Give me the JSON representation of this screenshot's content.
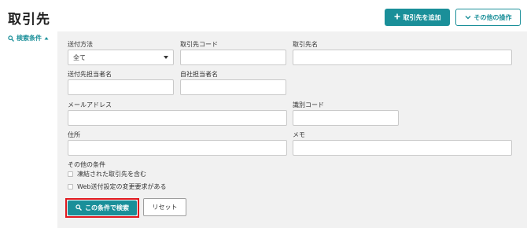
{
  "page": {
    "title": "取引先"
  },
  "header": {
    "add_button_label": "取引先を追加",
    "other_ops_label": "その他の操作"
  },
  "sidebar": {
    "search_toggle_label": "検索条件"
  },
  "form": {
    "delivery_method": {
      "label": "送付方法",
      "value": "全て"
    },
    "partner_code": {
      "label": "取引先コード",
      "value": ""
    },
    "partner_name": {
      "label": "取引先名",
      "value": ""
    },
    "recipient_contact": {
      "label": "送付先担当者名",
      "value": ""
    },
    "own_contact": {
      "label": "自社担当者名",
      "value": ""
    },
    "email": {
      "label": "メールアドレス",
      "value": ""
    },
    "id_code": {
      "label": "識別コード",
      "value": ""
    },
    "address": {
      "label": "住所",
      "value": ""
    },
    "memo": {
      "label": "メモ",
      "value": ""
    },
    "other_conditions": {
      "label": "その他の条件",
      "options": [
        {
          "label": "凍結された取引先を含む",
          "checked": false
        },
        {
          "label": "Web送付設定の変更要求がある",
          "checked": false
        }
      ]
    },
    "search_button_label": "この条件で検索",
    "reset_button_label": "リセット"
  },
  "colors": {
    "accent": "#1a8f99",
    "highlight": "#e0191f",
    "panel_bg": "#f1f1f1"
  }
}
